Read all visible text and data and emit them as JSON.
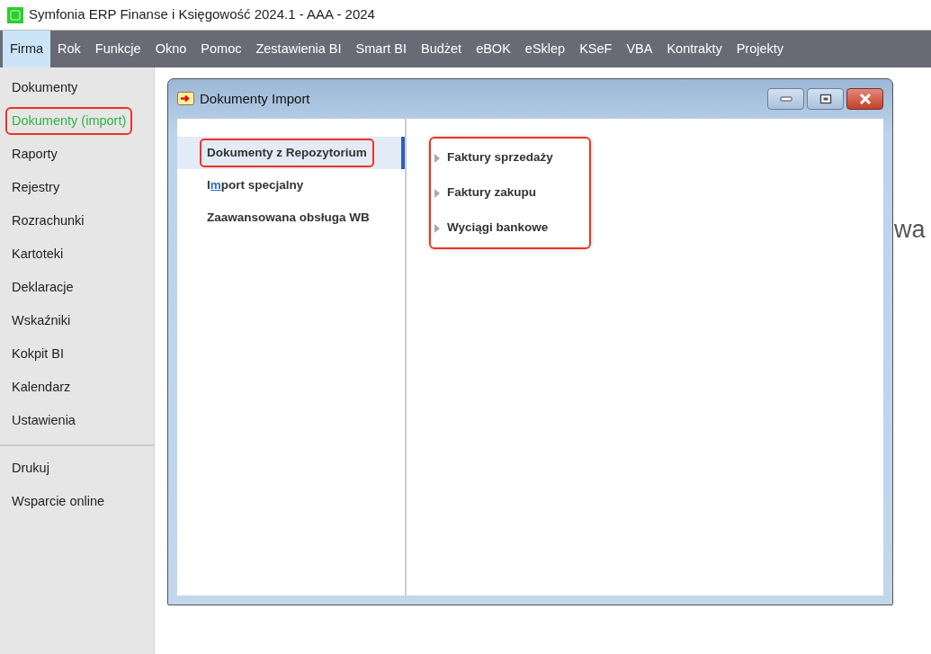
{
  "app_title": "Symfonia ERP Finanse i Księgowość 2024.1 - AAA - 2024",
  "menu": [
    {
      "label": "Firma",
      "selected": true
    },
    {
      "label": "Rok",
      "selected": false
    },
    {
      "label": "Funkcje",
      "selected": false
    },
    {
      "label": "Okno",
      "selected": false
    },
    {
      "label": "Pomoc",
      "selected": false
    },
    {
      "label": "Zestawienia BI",
      "selected": false
    },
    {
      "label": "Smart BI",
      "selected": false
    },
    {
      "label": "Budżet",
      "selected": false
    },
    {
      "label": "eBOK",
      "selected": false
    },
    {
      "label": "eSklep",
      "selected": false
    },
    {
      "label": "KSeF",
      "selected": false
    },
    {
      "label": "VBA",
      "selected": false
    },
    {
      "label": "Kontrakty",
      "selected": false
    },
    {
      "label": "Projekty",
      "selected": false
    }
  ],
  "sidebar": {
    "groups": [
      [
        {
          "label": "Dokumenty",
          "selected": false,
          "highlighted": false
        },
        {
          "label": "Dokumenty (import)",
          "selected": true,
          "highlighted": true
        },
        {
          "label": "Raporty",
          "selected": false,
          "highlighted": false
        },
        {
          "label": "Rejestry",
          "selected": false,
          "highlighted": false
        },
        {
          "label": "Rozrachunki",
          "selected": false,
          "highlighted": false
        },
        {
          "label": "Kartoteki",
          "selected": false,
          "highlighted": false
        },
        {
          "label": "Deklaracje",
          "selected": false,
          "highlighted": false
        },
        {
          "label": "Wskaźniki",
          "selected": false,
          "highlighted": false
        },
        {
          "label": "Kokpit BI",
          "selected": false,
          "highlighted": false
        },
        {
          "label": "Kalendarz",
          "selected": false,
          "highlighted": false
        },
        {
          "label": "Ustawienia",
          "selected": false,
          "highlighted": false
        }
      ],
      [
        {
          "label": "Drukuj",
          "selected": false,
          "highlighted": false
        },
        {
          "label": "Wsparcie online",
          "selected": false,
          "highlighted": false
        }
      ]
    ]
  },
  "background_text": "wa",
  "dialog": {
    "title": "Dokumenty Import",
    "categories": [
      {
        "label_after": "Dokumenty z Repozytorium",
        "selected": true,
        "highlighted": true
      },
      {
        "label_before": "I",
        "access_key": "m",
        "label_after": "port specjalny",
        "selected": false,
        "highlighted": false
      },
      {
        "label_after": "Zaawansowana obsługa WB",
        "selected": false,
        "highlighted": false
      }
    ],
    "options_highlighted": true,
    "options": [
      {
        "label": "Faktury sprzedaży"
      },
      {
        "label": "Faktury zakupu"
      },
      {
        "label": "Wyciągi bankowe"
      }
    ]
  }
}
